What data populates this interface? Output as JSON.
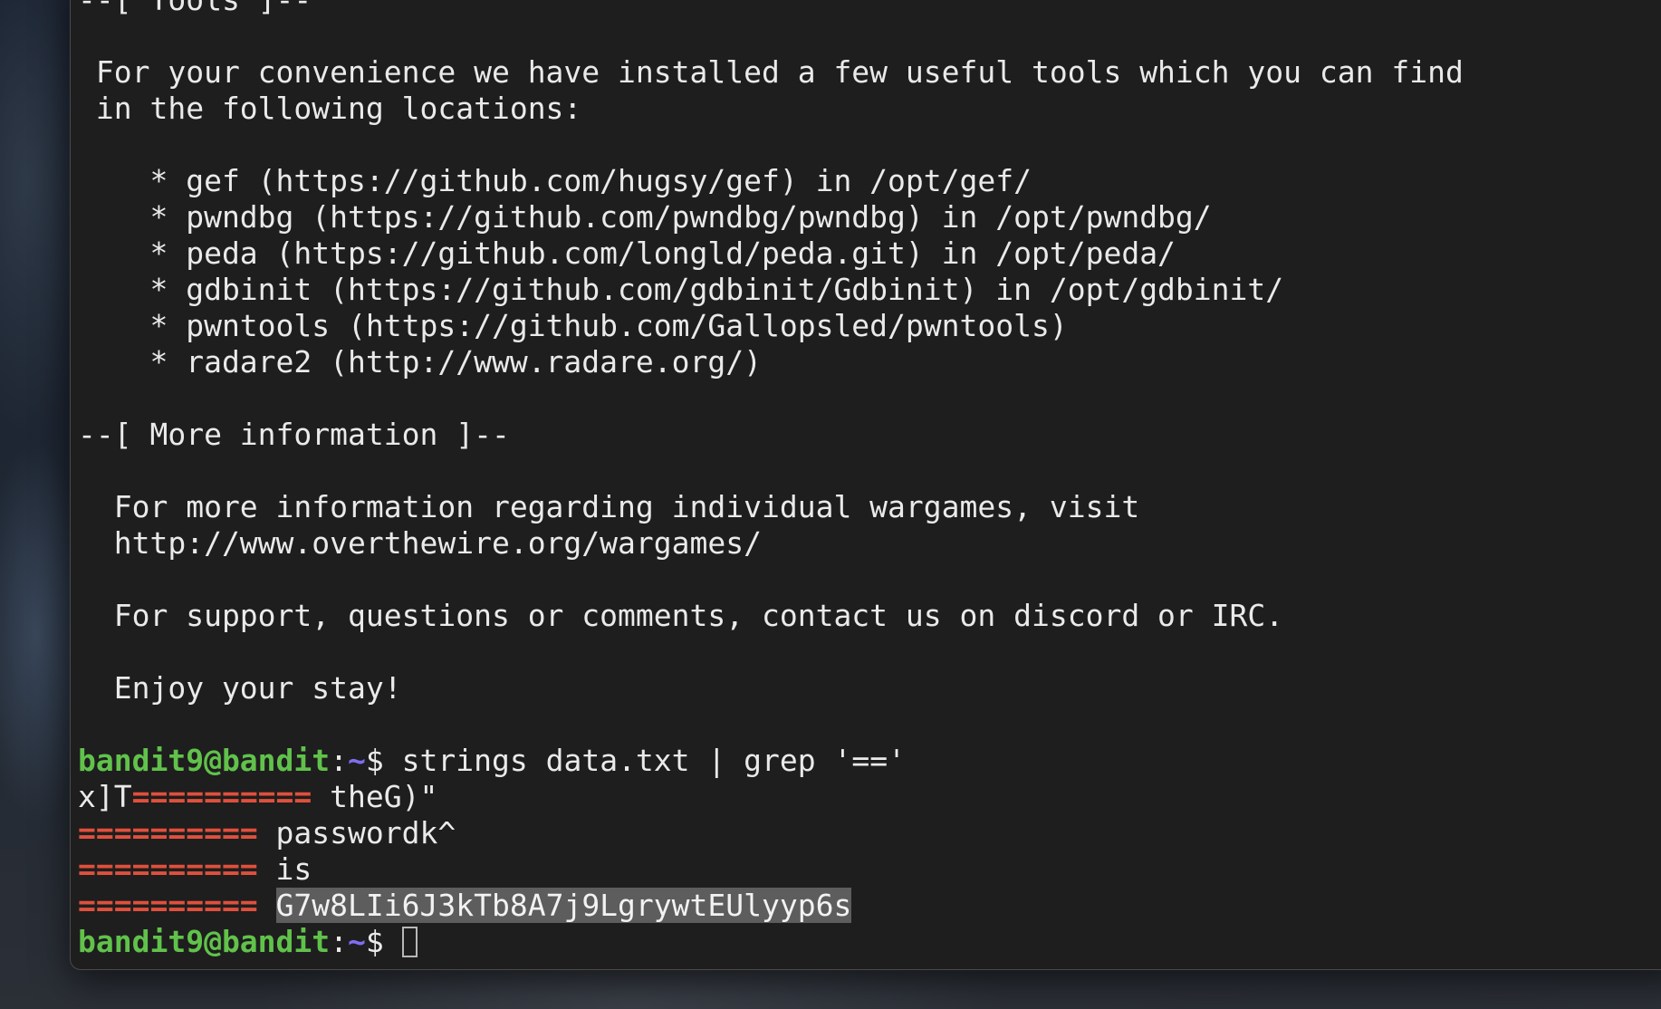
{
  "colors": {
    "terminal_bg": "#1e1e1e",
    "text": "#eaeaea",
    "prompt_user": "#61c24b",
    "prompt_path": "#7f6df2",
    "grep_match": "#e0503c",
    "selection_bg": "#5d5d5d"
  },
  "terminal": {
    "lines": [
      "--[ Tools ]--",
      "",
      " For your convenience we have installed a few useful tools which you can find",
      " in the following locations:",
      "",
      "    * gef (https://github.com/hugsy/gef) in /opt/gef/",
      "    * pwndbg (https://github.com/pwndbg/pwndbg) in /opt/pwndbg/",
      "    * peda (https://github.com/longld/peda.git) in /opt/peda/",
      "    * gdbinit (https://github.com/gdbinit/Gdbinit) in /opt/gdbinit/",
      "    * pwntools (https://github.com/Gallopsled/pwntools)",
      "    * radare2 (http://www.radare.org/)",
      "",
      "--[ More information ]--",
      "",
      "  For more information regarding individual wargames, visit",
      "  http://www.overthewire.org/wargames/",
      "",
      "  For support, questions or comments, contact us on discord or IRC.",
      "",
      "  Enjoy your stay!",
      ""
    ],
    "prompt": {
      "user": "bandit9@bandit",
      "colon": ":",
      "path": "~",
      "dollar": "$ "
    },
    "command": "strings data.txt | grep '=='",
    "output": {
      "line1_prefix": "x]T",
      "line1_match": "==========",
      "line1_rest": " theG)\"",
      "line2_match": "==========",
      "line2_rest": " passwordk^",
      "line3_match": "==========",
      "line3_rest": " is",
      "line4_match": "==========",
      "line4_space": " ",
      "line4_password": "G7w8LIi6J3kTb8A7j9LgrywtEUlyyp6s"
    }
  }
}
